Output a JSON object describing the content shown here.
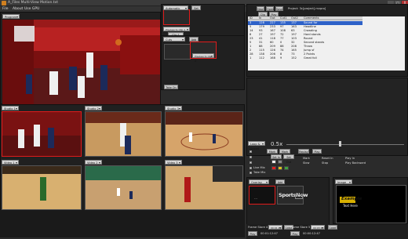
{
  "window": {
    "title": "A_Files Multi-View Motion.txt"
  },
  "menu": [
    "File",
    "About",
    "Use GPU"
  ],
  "window_controls": [
    "_",
    "□",
    "X"
  ],
  "main": {
    "source": "Program"
  },
  "panel1": {
    "select": "Automatic",
    "btn": "Set",
    "value": "Preview to Clip 1",
    "clip": "Clip 1"
  },
  "panel2": {
    "select": "Cuts",
    "btn": "Add",
    "value": "Preview to Clip 2",
    "take": "Take On"
  },
  "toolbar": {
    "new": "New",
    "open": "Open",
    "save": "Save",
    "project": "Project: 3c[project].mvpro]"
  },
  "tabs": [
    "Clip",
    "Play"
  ],
  "table": {
    "headers": [
      "ID",
      "In",
      "Out",
      "Cut1",
      "Out2",
      "Comments"
    ],
    "rows": [
      [
        "3",
        "128",
        "227",
        "135",
        "137",
        "Sound for"
      ],
      [
        "5",
        "179",
        "233",
        "97",
        "163",
        "Headline"
      ],
      [
        "14",
        "93",
        "167",
        "108",
        "63",
        "Crowding"
      ],
      [
        "8",
        "27",
        "197",
        "72",
        "197",
        "Hard stands"
      ],
      [
        "23",
        "41",
        "118",
        "77",
        "103",
        "Round"
      ],
      [
        "5",
        "31",
        "60",
        "0",
        "32",
        "Second stands"
      ],
      [
        "1",
        "88",
        "209",
        "88",
        "208",
        "Throw"
      ],
      [
        "2",
        "115",
        "126",
        "74",
        "165",
        "Jump sf"
      ],
      [
        "28",
        "138",
        "206",
        "8",
        "73",
        "2 Points"
      ],
      [
        "1",
        "112",
        "168",
        "9",
        "152",
        "Great foil"
      ]
    ],
    "selected_row": 0
  },
  "video_labels": [
    "Studio 1",
    "Studio 2",
    "Studio 3",
    "Video 1",
    "Video 2",
    "Video 3"
  ],
  "speed": {
    "label": "Loop & Speed",
    "value": "0.5x"
  },
  "controls": {
    "playback": [
      "Mark In",
      "Mark Out",
      "Replay",
      "Play"
    ],
    "marks": [
      "Set In",
      "Set Out"
    ],
    "radio": [
      "Mark",
      "Slow",
      "Reset In",
      "Stop",
      "Play In",
      "Play Backward"
    ],
    "check_labels": [
      "Live Mix",
      "Take Mix"
    ],
    "swatch_colors": [
      "#e02020",
      "#d8c020",
      "#40a040",
      "#e0c020"
    ]
  },
  "overlay": {
    "select": "Overlay Solo",
    "add": "Add",
    "logo": "SportsNow"
  },
  "dsk": {
    "select": "Image",
    "title": "Example",
    "subtitle": "Text Here"
  },
  "bottom": {
    "left_label": "Frame Store 4",
    "left_value": "00:01:12:47",
    "left_btn": "Load",
    "left_play": "Play",
    "right_label": "Frame Store 5",
    "right_value": "00:03:12:47",
    "right_btn": "Load",
    "right_play": "Play",
    "left_time": "00:01:12:47",
    "right_time": "00:00:12:47"
  }
}
